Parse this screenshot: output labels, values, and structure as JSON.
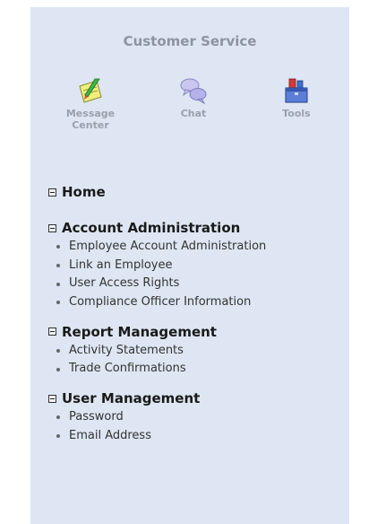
{
  "header": {
    "title": "Customer Service"
  },
  "tools": [
    {
      "label": "Message\nCenter",
      "icon": "notepad-pencil-icon"
    },
    {
      "label": "Chat",
      "icon": "chat-bubbles-icon"
    },
    {
      "label": "Tools",
      "icon": "toolbox-icon"
    }
  ],
  "nav": {
    "home": {
      "title": "Home"
    },
    "account": {
      "title": "Account Administration",
      "items": [
        "Employee Account Administration",
        "Link an Employee",
        "User Access Rights",
        "Compliance Officer Information"
      ]
    },
    "report": {
      "title": "Report Management",
      "items": [
        "Activity Statements",
        "Trade Confirmations"
      ]
    },
    "user": {
      "title": "User Management",
      "items": [
        "Password",
        "Email Address"
      ]
    }
  },
  "colors": {
    "panel_bg": "#dde6f2",
    "title_gray": "#8d94a0"
  }
}
